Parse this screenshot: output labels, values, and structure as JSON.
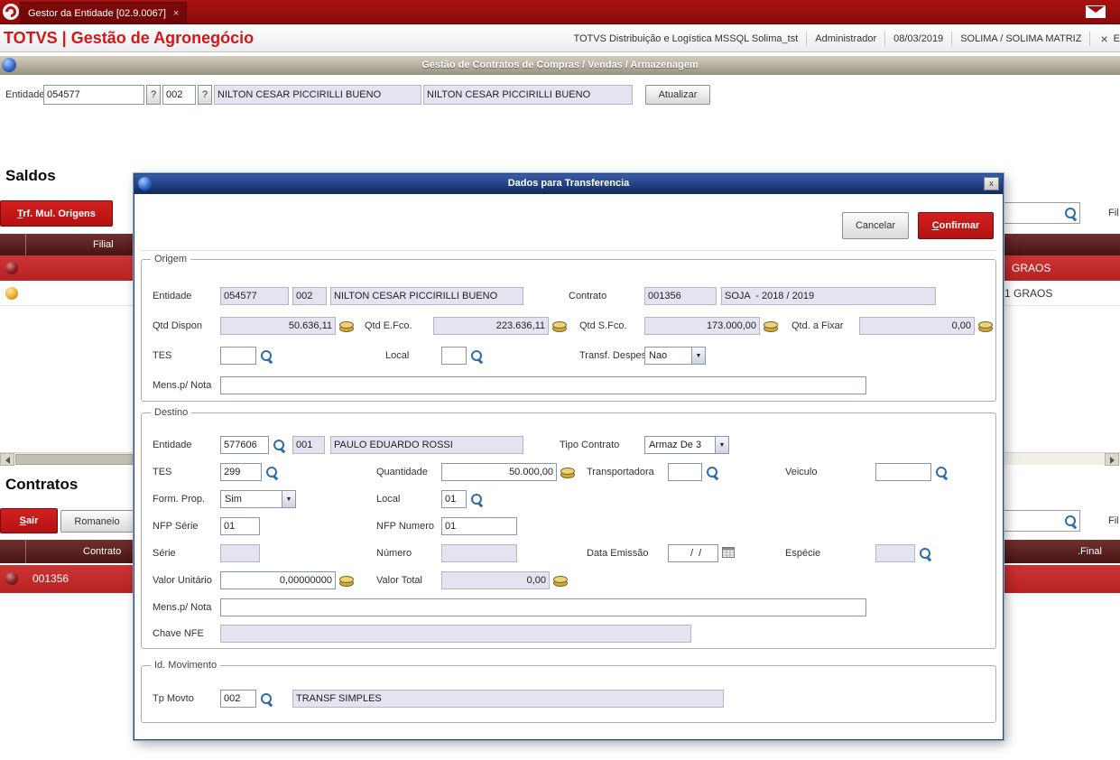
{
  "colors": {
    "brand_red": "#d41717",
    "topbar_red": "#9c0d0d",
    "modal_title_blue": "#1d3a74",
    "grid_header_maroon": "#5e1616",
    "row_selected_red": "#c32b2b",
    "readonly_field": "#e4e4f1"
  },
  "taskbar": {
    "tab_title": "Gestor da Entidade [02.9.0067]",
    "tab_close": "×"
  },
  "header": {
    "brand": "TOTVS | Gestão de Agronegócio",
    "environment": "TOTVS Distribuição e Logística MSSQL Solima_tst",
    "user": "Administrador",
    "date": "08/03/2019",
    "company": "SOLIMA / SOLIMA MATRIZ",
    "close": "×",
    "edge_label": "E"
  },
  "window_bar": {
    "title": "Gestão de Contratos de Compras / Vendas / Armazenagem"
  },
  "entity_bar": {
    "label": "Entidade",
    "code": "054577",
    "lookup1": "?",
    "store": "002",
    "lookup2": "?",
    "name": "NILTON CESAR PICCIRILLI BUENO",
    "name2": "NILTON CESAR PICCIRILLI BUENO",
    "refresh_button": "Atualizar"
  },
  "saldos": {
    "heading": "Saldos",
    "trf_button": "Trf. Mul. Origens",
    "search_value": "",
    "filter_label": "Fil",
    "col_filial": "Filial",
    "rows": [
      {
        "right_text": "GRAOS"
      },
      {
        "right_text": "1 GRAOS"
      }
    ]
  },
  "contratos": {
    "heading": "Contratos",
    "sair_button": "Sair",
    "romaneio_button": "Romaneio",
    "search_value": "",
    "filter_label": "Fil",
    "col_contrato": "Contrato",
    "col_final": ".Final",
    "rows": [
      {
        "contrato": "001356"
      }
    ]
  },
  "modal": {
    "title": "Dados para Transferencia",
    "close": "x",
    "cancel_button": "Cancelar",
    "confirm_button": "Confirmar",
    "origem": {
      "legend": "Origem",
      "entidade_label": "Entidade",
      "entidade_code": "054577",
      "entidade_store": "002",
      "entidade_name": "NILTON CESAR PICCIRILLI BUENO",
      "contrato_label": "Contrato",
      "contrato_code": "001356",
      "contrato_desc": "SOJA  - 2018 / 2019",
      "qtd_dispon_label": "Qtd Dispon",
      "qtd_dispon": "50.636,11",
      "qtd_efco_label": "Qtd E.Fco.",
      "qtd_efco": "223.636,11",
      "qtd_sfco_label": "Qtd S.Fco.",
      "qtd_sfco": "173.000,00",
      "qtd_fixar_label": "Qtd. a Fixar",
      "qtd_fixar": "0,00",
      "tes_label": "TES",
      "tes_value": "",
      "local_label": "Local",
      "local_value": "",
      "transf_despesa_label": "Transf. Despesa",
      "transf_despesa_value": "Nao",
      "mens_label": "Mens.p/ Nota",
      "mens_value": ""
    },
    "destino": {
      "legend": "Destino",
      "entidade_label": "Entidade",
      "entidade_code": "577606",
      "entidade_store": "001",
      "entidade_name": "PAULO EDUARDO ROSSI",
      "tipo_contrato_label": "Tipo Contrato",
      "tipo_contrato_value": "Armaz De 3",
      "tes_label": "TES",
      "tes_value": "299",
      "quantidade_label": "Quantidade",
      "quantidade_value": "50.000,00",
      "transportadora_label": "Transportadora",
      "transportadora_value": "",
      "veiculo_label": "Veiculo",
      "veiculo_value": "",
      "form_prop_label": "Form. Prop.",
      "form_prop_value": "Sim",
      "local_label": "Local",
      "local_value": "01",
      "nfp_serie_label": "NFP Série",
      "nfp_serie_value": "01",
      "nfp_numero_label": "NFP Numero",
      "nfp_numero_value": "01",
      "serie_label": "Série",
      "serie_value": "",
      "numero_label": "Número",
      "numero_value": "",
      "data_emissao_label": "Data Emissão",
      "data_emissao_value": "  /  /",
      "especie_label": "Espécie",
      "especie_value": "",
      "valor_unitario_label": "Valor Unitário",
      "valor_unitario_value": "0,00000000",
      "valor_total_label": "Valor Total",
      "valor_total_value": "0,00",
      "mens_label": "Mens.p/ Nota",
      "mens_value": "",
      "chave_nfe_label": "Chave NFE",
      "chave_nfe_value": ""
    },
    "id_movimento": {
      "legend": "Id. Movimento",
      "tp_movto_label": "Tp Movto",
      "tp_movto_code": "002",
      "tp_movto_desc": "TRANSF SIMPLES"
    }
  }
}
